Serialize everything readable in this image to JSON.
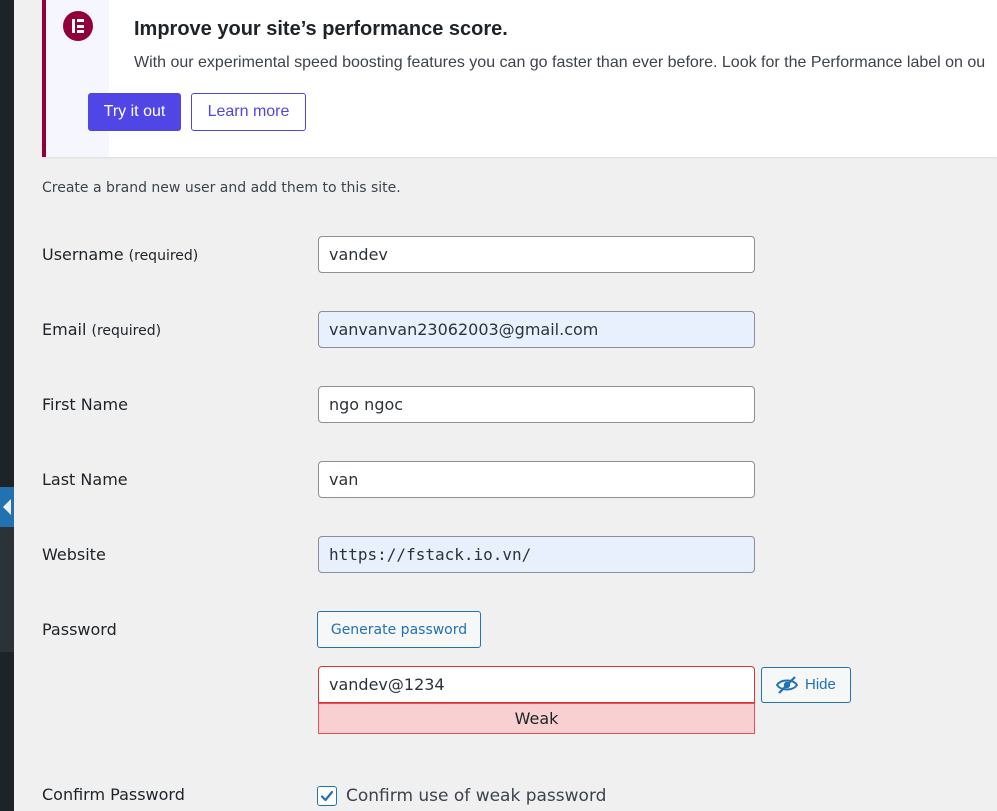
{
  "notice": {
    "icon": "elementor-logo-icon",
    "title": "Improve your site’s performance score.",
    "description": "With our experimental speed boosting features you can go faster than ever before. Look for the Performance label on ou",
    "try_button": "Try it out",
    "learn_button": "Learn more",
    "brand_color": "#92003b",
    "accent_color": "#5046e5"
  },
  "intro": "Create a brand new user and add them to this site.",
  "form": {
    "username": {
      "label": "Username",
      "required": "(required)",
      "value": "vandev"
    },
    "email": {
      "label": "Email",
      "required": "(required)",
      "value": "vanvanvan23062003@gmail.com"
    },
    "first_name": {
      "label": "First Name",
      "value": "ngo ngoc"
    },
    "last_name": {
      "label": "Last Name",
      "value": "van"
    },
    "website": {
      "label": "Website",
      "value": "https://fstack.io.vn/"
    },
    "password": {
      "label": "Password",
      "generate_button": "Generate password",
      "value": "vandev@1234",
      "strength": "Weak",
      "hide_button": "Hide",
      "hide_icon": "eye-slash-icon"
    },
    "confirm_password": {
      "label": "Confirm Password",
      "checkbox_label": "Confirm use of weak password",
      "checked": true
    }
  }
}
